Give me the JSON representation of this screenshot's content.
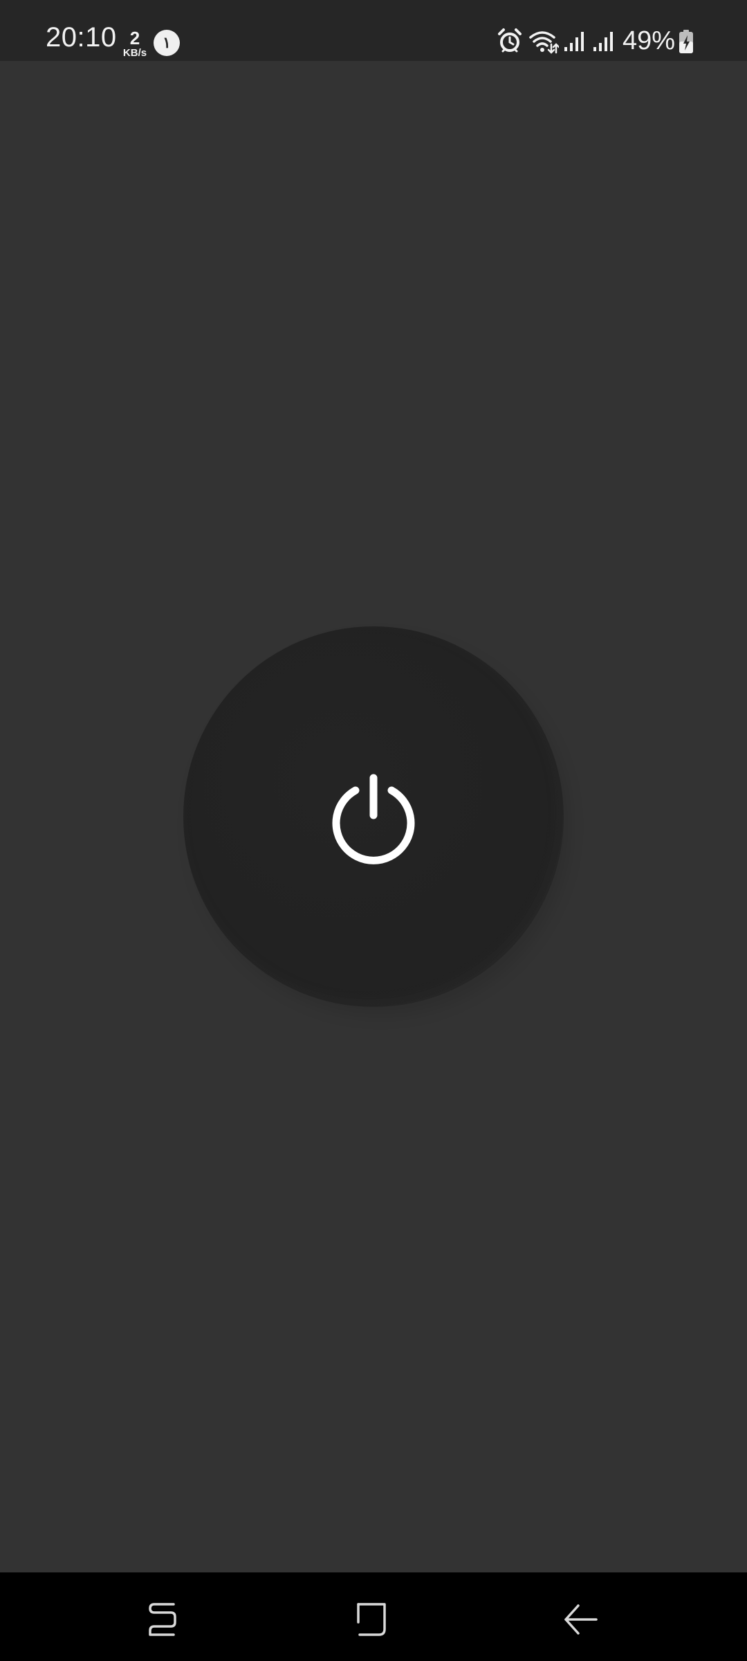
{
  "status_bar": {
    "time": "20:10",
    "net_speed_value": "2",
    "net_speed_unit": "KB/s",
    "notification_badge": "١",
    "battery_percent": "49%",
    "icons": [
      "alarm-icon",
      "wifi-icon",
      "signal-icon",
      "signal-icon",
      "battery-charging-icon"
    ]
  },
  "main": {
    "power_button_icon": "power-icon",
    "background_color": "#333333",
    "button_color": "#222222",
    "icon_color": "#ffffff"
  },
  "nav_bar": {
    "items": [
      "recents-icon",
      "home-icon",
      "back-icon"
    ]
  }
}
